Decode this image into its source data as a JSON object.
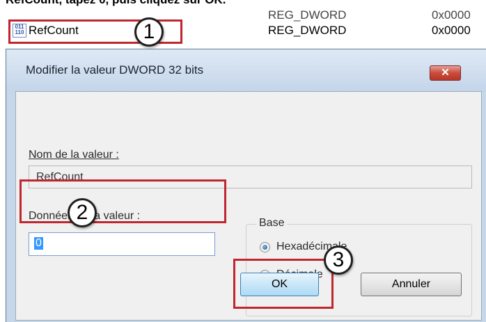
{
  "instruction": "RefCount, tapez 0, puis cliquez sur OK.",
  "registry": {
    "value_name": "RefCount",
    "value_type": "REG_DWORD",
    "value_data_partial": "0x0000",
    "prev_type_partial": "REG_DWORD",
    "prev_data_partial": "0x0000",
    "icon": "registry-value-icon"
  },
  "dialog": {
    "title": "Modifier la valeur DWORD 32 bits",
    "close_label": "✕",
    "name_label": "Nom de la valeur :",
    "name_value": "RefCount",
    "data_label": "Données de la valeur :",
    "data_value": "0",
    "base_label": "Base",
    "radio_hex": "Hexadécimale",
    "radio_dec": "Décimale",
    "base_selected": "Hexadécimale",
    "ok_label": "OK",
    "cancel_label": "Annuler"
  },
  "annotations": {
    "step1": "1",
    "step2": "2",
    "step3": "3",
    "color": "#c0262d"
  }
}
